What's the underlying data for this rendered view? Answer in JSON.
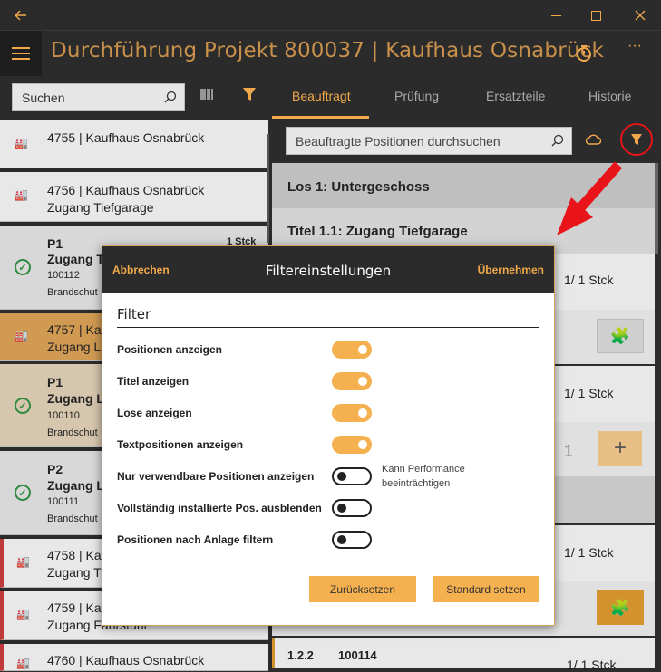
{
  "window": {
    "back_icon": "arrow-left",
    "min": "–",
    "max": "☐",
    "close": "✕"
  },
  "header": {
    "title": "Durchführung Projekt 800037  |  Kaufhaus Osnabrück",
    "ellipsis": "···"
  },
  "left": {
    "search_placeholder": "Suchen",
    "items": [
      {
        "line1": "4755  |  Kaufhaus Osnabrück"
      },
      {
        "line1": "4756  |  Kaufhaus Osnabrück",
        "line2": "Zugang Tiefgarage"
      },
      {
        "p": "P1",
        "qty": "1 Stck",
        "name": "Zugang T",
        "num": "100112",
        "desc": "Brandschut"
      },
      {
        "line1": "4757  |  Ka",
        "line2": "Zugang L"
      },
      {
        "p": "P1",
        "name": "Zugang L",
        "num": "100110",
        "desc": "Brandschut"
      },
      {
        "p": "P2",
        "name": "Zugang L",
        "num": "100111",
        "desc": "Brandschut"
      },
      {
        "line1": "4758  |  Ka",
        "line2": "Zugang Ti"
      },
      {
        "line1": "4759  |  Ka",
        "line2": "Zugang Fahrstuhl"
      },
      {
        "line1": "4760  |  Kaufhaus Osnabrück"
      }
    ]
  },
  "tabs": [
    "Beauftragt",
    "Prüfung",
    "Ersatzteile",
    "Historie"
  ],
  "right": {
    "search_placeholder": "Beauftragte Positionen durchsuchen",
    "los": "Los 1: Untergeschoss",
    "titel": "Titel 1.1: Zugang Tiefgarage",
    "qty1": "1/ 1 Stck",
    "qty2": "1/ 1 Stck",
    "stepper_val": "1",
    "qty3": "1/ 1 Stck",
    "pos_num": "1.2.2",
    "pos_id": "100114",
    "qty4": "1/ 1 Stck"
  },
  "dialog": {
    "cancel": "Abbrechen",
    "title": "Filtereinstellungen",
    "apply": "Übernehmen",
    "section": "Filter",
    "rows": [
      {
        "label": "Positionen anzeigen",
        "on": true
      },
      {
        "label": "Titel anzeigen",
        "on": true
      },
      {
        "label": "Lose anzeigen",
        "on": true
      },
      {
        "label": "Textpositionen anzeigen",
        "on": true
      },
      {
        "label": "Nur verwendbare Positionen anzeigen",
        "on": false
      },
      {
        "label": "Vollständig installierte Pos. ausblenden",
        "on": false
      },
      {
        "label": "Positionen nach Anlage filtern",
        "on": false
      }
    ],
    "note_line1": "Kann Performance",
    "note_line2": "beeinträchtigen",
    "reset": "Zurücksetzen",
    "default": "Standard setzen"
  },
  "colors": {
    "accent": "#f0a94a",
    "toggle_on": "#f5b050",
    "annotation_red": "#e8141a"
  }
}
